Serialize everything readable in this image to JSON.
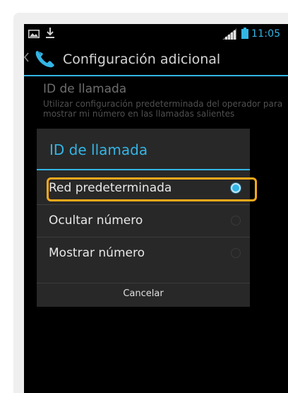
{
  "statusbar": {
    "time": "11:05",
    "icons": [
      "image-icon",
      "download-icon",
      "signal-icon",
      "battery-icon"
    ]
  },
  "actionbar": {
    "title": "Configuración adicional",
    "icon": "phone-icon",
    "back_icon": "chevron-left-icon"
  },
  "preference": {
    "title": "ID de llamada",
    "summary": "Utilizar configuración predeterminada del operador para mostrar mi número en las llamadas salientes"
  },
  "dialog": {
    "title": "ID de llamada",
    "options": [
      {
        "label": "Red predeterminada",
        "checked": true
      },
      {
        "label": "Ocultar número",
        "checked": false
      },
      {
        "label": "Mostrar número",
        "checked": false
      }
    ],
    "cancel_label": "Cancelar"
  },
  "colors": {
    "accent": "#33b5e5",
    "highlight": "#f5a81a",
    "dialog_bg": "#282828",
    "screen_bg": "#000000"
  }
}
